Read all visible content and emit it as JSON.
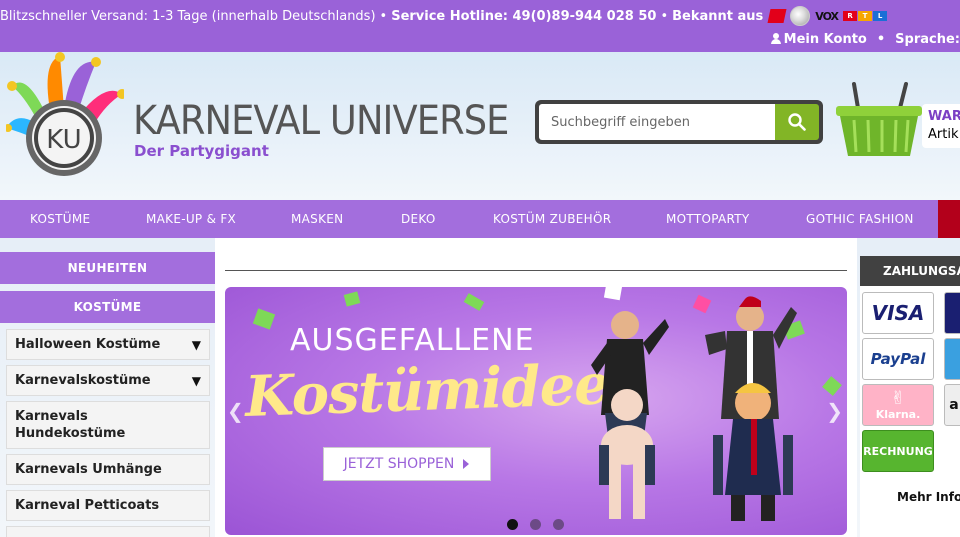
{
  "topbar": {
    "shipping": "Blitzschneller Versand: 1-3 Tage (innerhalb Deutschlands)",
    "bullet": "•",
    "hotline": "Service Hotline: 49(0)89-944 028 50",
    "known_from": "Bekannt aus",
    "vox": "VOX",
    "rtl": [
      "R",
      "T",
      "L"
    ],
    "account": "Mein Konto",
    "language": "Sprache:"
  },
  "header": {
    "logo_initials": "KU",
    "brand": "KARNEVAL UNIVERSE",
    "tagline": "Der Partygigant",
    "search_placeholder": "Suchbegriff eingeben",
    "cart_line1": "WAR",
    "cart_line2": "Artik"
  },
  "nav": [
    "KOSTÜME",
    "MAKE-UP & FX",
    "MASKEN",
    "DEKO",
    "KOSTÜM ZUBEHÖR",
    "MOTTOPARTY",
    "GOTHIC FASHION"
  ],
  "sidebar": {
    "headers": [
      "NEUHEITEN",
      "KOSTÜME"
    ],
    "items": [
      {
        "label": "Halloween Kostüme",
        "arrow": "▼"
      },
      {
        "label": "Karnevalskostüme",
        "arrow": "▼"
      },
      {
        "label": "Karnevals Hundekostüme",
        "arrow": ""
      },
      {
        "label": "Karnevals Umhänge",
        "arrow": ""
      },
      {
        "label": "Karneval Petticoats",
        "arrow": ""
      }
    ]
  },
  "banner": {
    "title_line1": "AUSGEFALLENE",
    "title_line2": "Kostümideen",
    "cta": "JETZT SHOPPEN",
    "slides": 3,
    "active_slide": 1
  },
  "payment": {
    "header": "ZAHLUNGSART",
    "methods": [
      "VISA",
      "PayPal",
      "Klarna.",
      "RECHNUNG"
    ],
    "more_info": "Mehr Info"
  },
  "colors": {
    "purple": "#9a62d8",
    "nav_purple": "#a36edd",
    "green": "#82b526",
    "dark": "#414141"
  }
}
